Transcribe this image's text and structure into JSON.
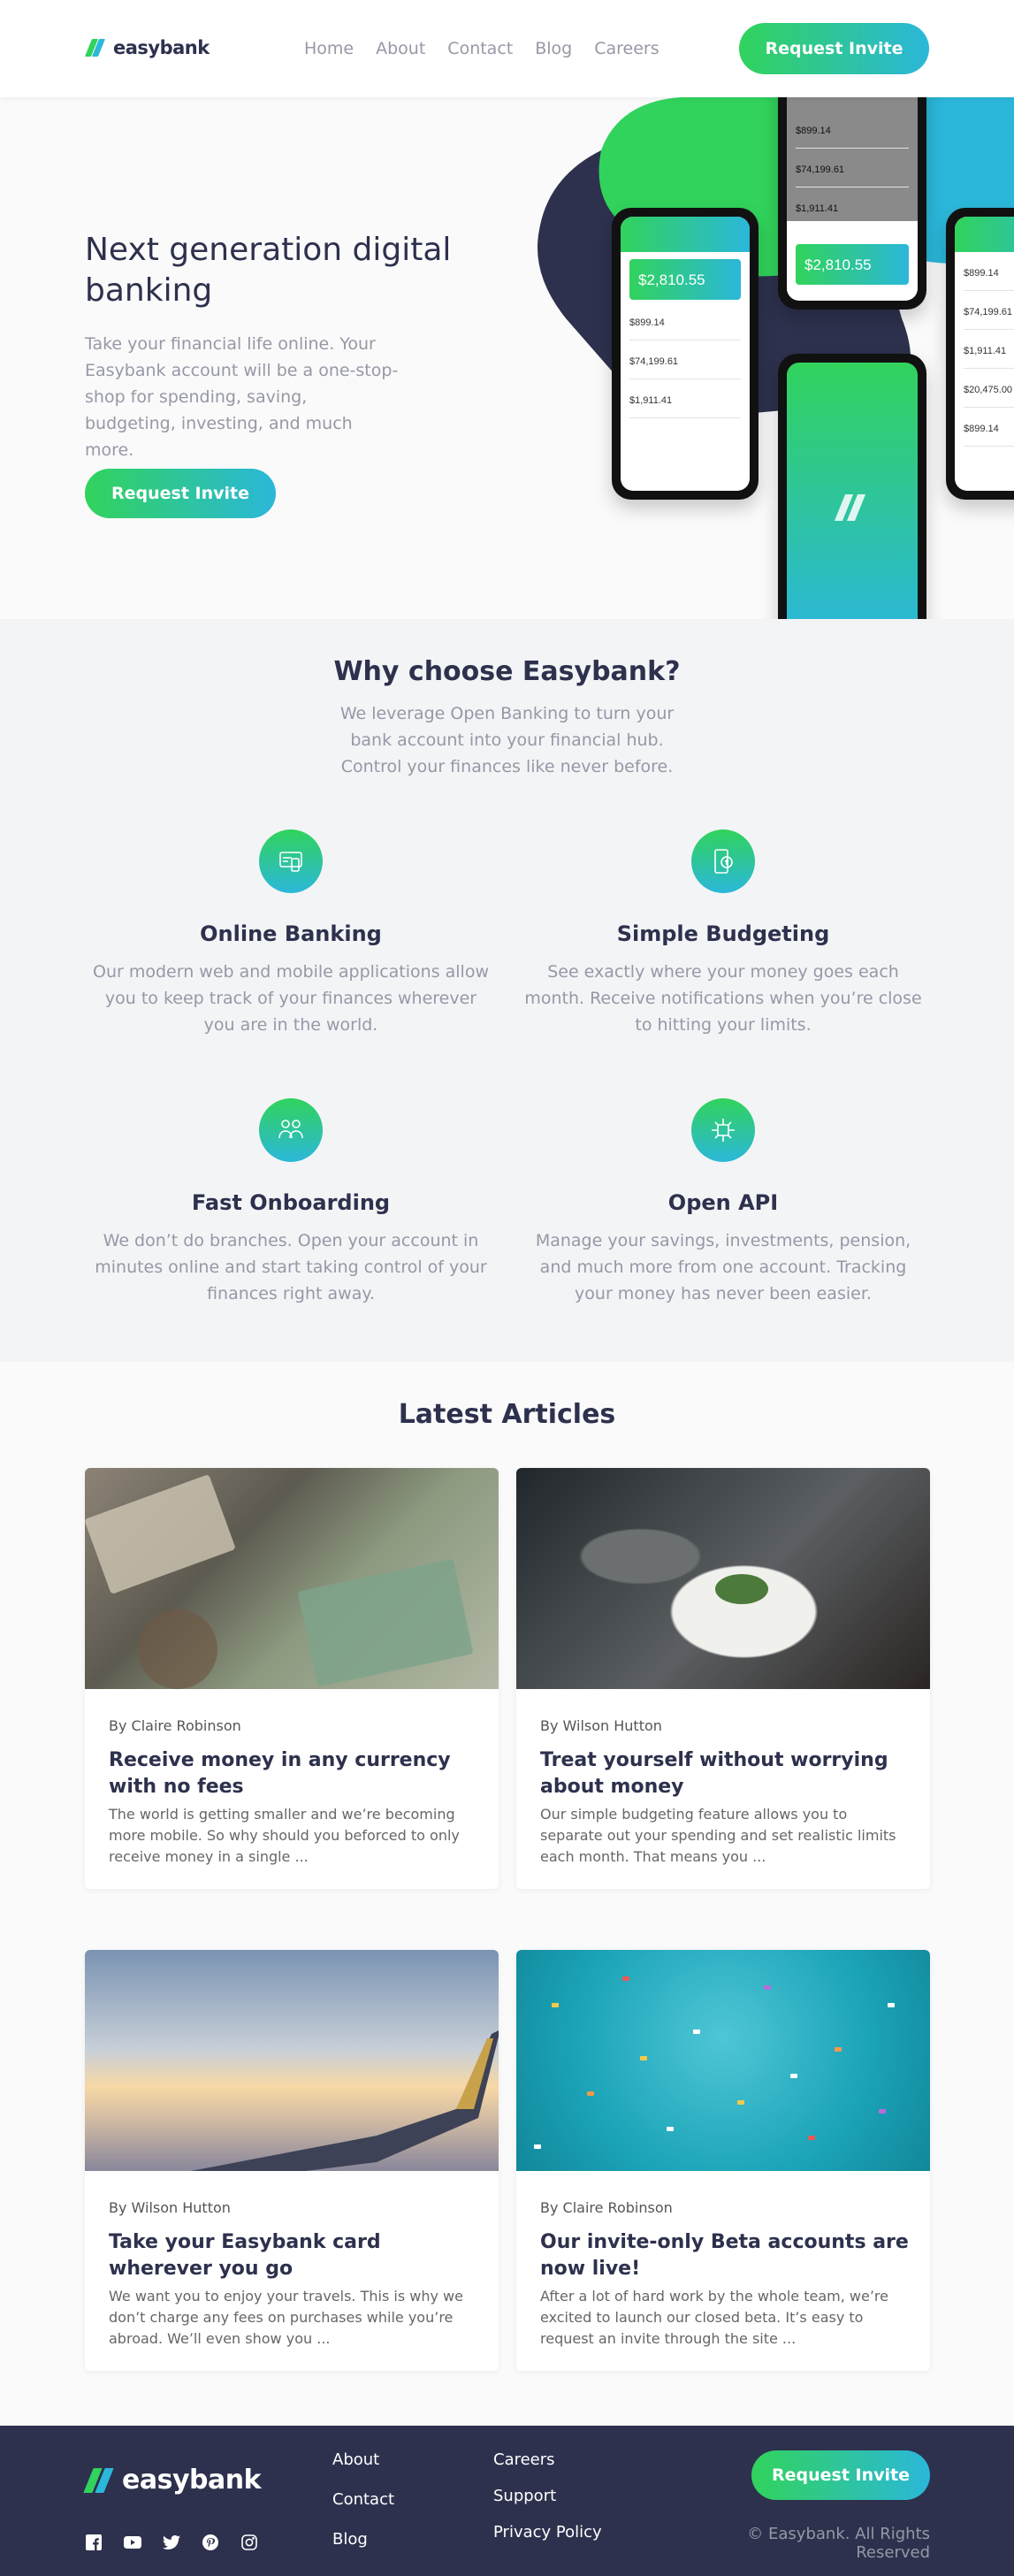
{
  "header": {
    "logo_text": "easybank",
    "nav": [
      "Home",
      "About",
      "Contact",
      "Blog",
      "Careers"
    ],
    "cta_label": "Request Invite"
  },
  "hero": {
    "title": "Next generation digital banking",
    "text": "Take your financial life online. Your Easybank account will be a one-stop-shop for spending, saving, budgeting, investing, and much more.",
    "cta_label": "Request Invite",
    "mockup": {
      "total_balance": "$2,810.55",
      "accounts": [
        "$899.14",
        "$74,199.61",
        "$1,911.41",
        "$20,475.00"
      ]
    }
  },
  "why": {
    "title": "Why choose Easybank?",
    "intro": "We leverage Open Banking to turn your bank account into your financial hub. Control your finances like never before.",
    "features": [
      {
        "title": "Online Banking",
        "text": "Our modern web and mobile applications allow you to keep track of your finances wherever you are in the world.",
        "icon": "online-banking-icon"
      },
      {
        "title": "Simple Budgeting",
        "text": "See exactly where your money goes each month. Receive notifications when you’re close to hitting your limits.",
        "icon": "budgeting-icon"
      },
      {
        "title": "Fast Onboarding",
        "text": "We don’t do branches. Open your account in minutes online and start taking control of your finances right away.",
        "icon": "onboarding-icon"
      },
      {
        "title": "Open API",
        "text": "Manage your savings, investments, pension, and much more from one account. Tracking your money has never been easier.",
        "icon": "api-icon"
      }
    ]
  },
  "articles": {
    "title": "Latest Articles",
    "items": [
      {
        "author": "By Claire Robinson",
        "title": "Receive money in any currency with no fees",
        "excerpt": "The world is getting smaller and we’re becoming more mobile. So why should you beforced to only receive money in a single ..."
      },
      {
        "author": "By Wilson Hutton",
        "title": "Treat yourself without worrying about money",
        "excerpt": "Our simple budgeting feature allows you to separate out your spending and set realistic limits each month. That means you ..."
      },
      {
        "author": "By Wilson Hutton",
        "title": "Take your Easybank card wherever you go",
        "excerpt": "We want you to enjoy your travels. This is why we don’t charge any fees on purchases while you’re abroad. We’ll even show you ..."
      },
      {
        "author": "By Claire Robinson",
        "title": "Our invite-only Beta accounts are now live!",
        "excerpt": "After a lot of hard work by the whole team, we’re excited to launch our closed beta. It’s easy to request an invite through the site ..."
      }
    ]
  },
  "footer": {
    "logo_text": "easybank",
    "links_col1": [
      "About",
      "Contact",
      "Blog"
    ],
    "links_col2": [
      "Careers",
      "Support",
      "Privacy Policy"
    ],
    "cta_label": "Request Invite",
    "copyright": "© Easybank. All Rights Reserved",
    "socials": [
      "facebook-icon",
      "youtube-icon",
      "twitter-icon",
      "pinterest-icon",
      "instagram-icon"
    ]
  },
  "colors": {
    "dark_blue": "#2d314d",
    "lime_green": "#31d35c",
    "bright_cyan": "#2bb7da",
    "grayish_blue": "#9698a6"
  }
}
